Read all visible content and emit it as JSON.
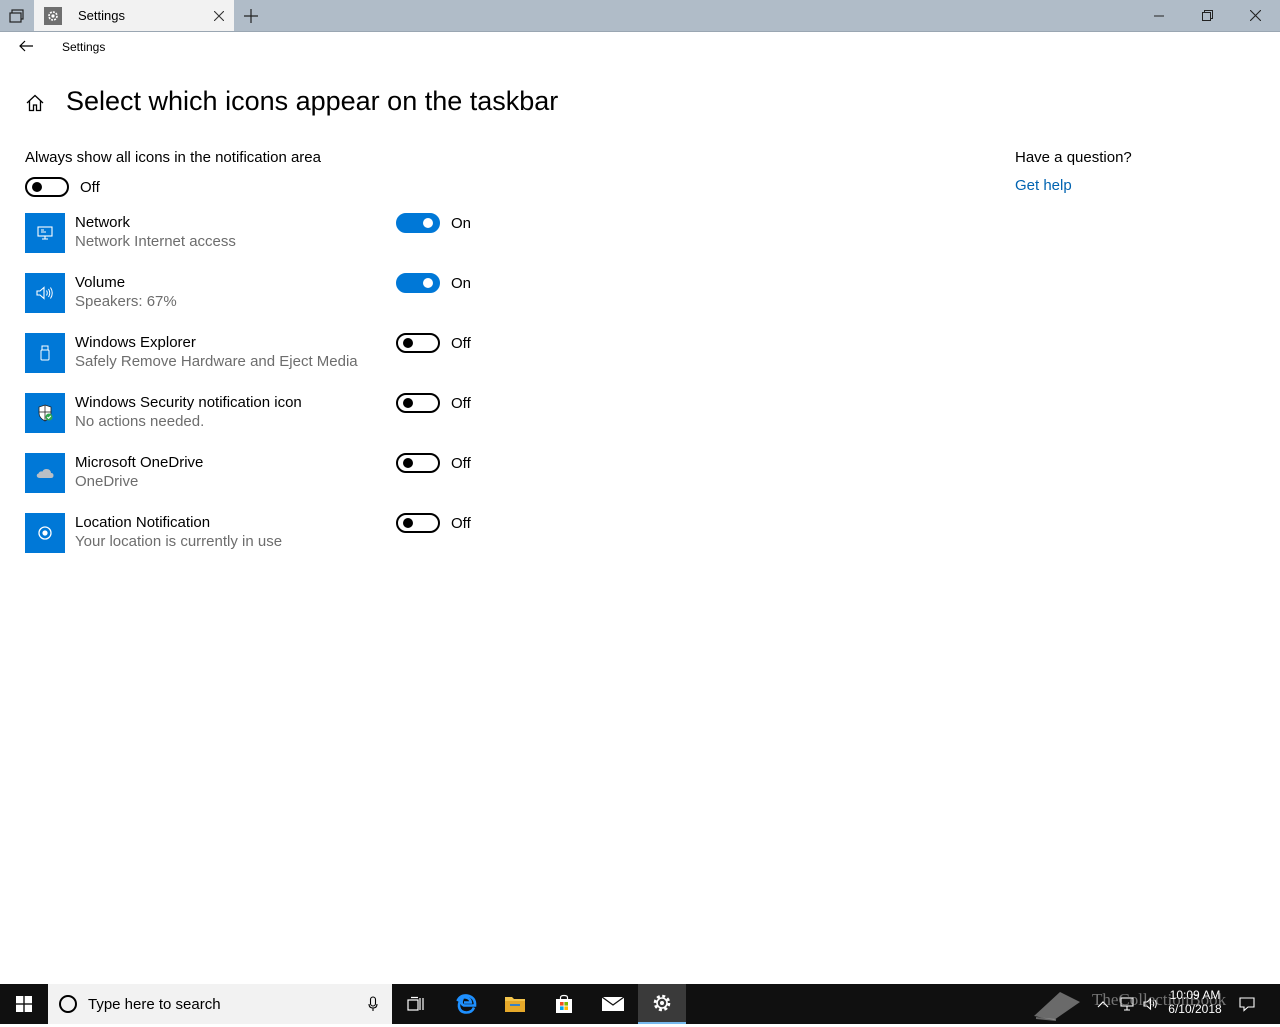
{
  "window": {
    "tab_title": "Settings",
    "app_name": "Settings",
    "icons": {
      "sets": "window-sets-icon",
      "tab": "gear-icon",
      "close_tab": "close-icon",
      "new_tab": "plus-icon",
      "minimize": "minimize-icon",
      "maximize": "restore-icon",
      "close": "close-icon"
    }
  },
  "header": {
    "back_icon": "back-arrow-icon",
    "home_icon": "home-icon",
    "page_title": "Select which icons appear on the taskbar"
  },
  "main": {
    "always_show": {
      "label": "Always show all icons in the notification area",
      "state": "Off",
      "on": false
    },
    "items": [
      {
        "name": "Network",
        "description": "Network Internet access",
        "state": "On",
        "on": true,
        "icon": "network-icon"
      },
      {
        "name": "Volume",
        "description": "Speakers: 67%",
        "state": "On",
        "on": true,
        "icon": "volume-icon"
      },
      {
        "name": "Windows Explorer",
        "description": "Safely Remove Hardware and Eject Media",
        "state": "Off",
        "on": false,
        "icon": "usb-drive-icon"
      },
      {
        "name": "Windows Security notification icon",
        "description": "No actions needed.",
        "state": "Off",
        "on": false,
        "icon": "shield-icon"
      },
      {
        "name": "Microsoft OneDrive",
        "description": "OneDrive",
        "state": "Off",
        "on": false,
        "icon": "cloud-icon"
      },
      {
        "name": "Location Notification",
        "description": "Your location is currently in use",
        "state": "Off",
        "on": false,
        "icon": "location-icon"
      }
    ]
  },
  "help": {
    "question": "Have a question?",
    "link": "Get help"
  },
  "taskbar": {
    "search_placeholder": "Type here to search",
    "apps": [
      "start-icon",
      "task-view-icon",
      "edge-icon",
      "file-explorer-icon",
      "store-icon",
      "mail-icon",
      "settings-icon"
    ],
    "watermark_text": "TheCollectionBook",
    "clock_time": "10:09 AM",
    "clock_date": "6/10/2018"
  },
  "colors": {
    "accent": "#0078d7",
    "link": "#0063b1",
    "titlebar": "#b0bcc8",
    "taskbar": "#101010"
  }
}
